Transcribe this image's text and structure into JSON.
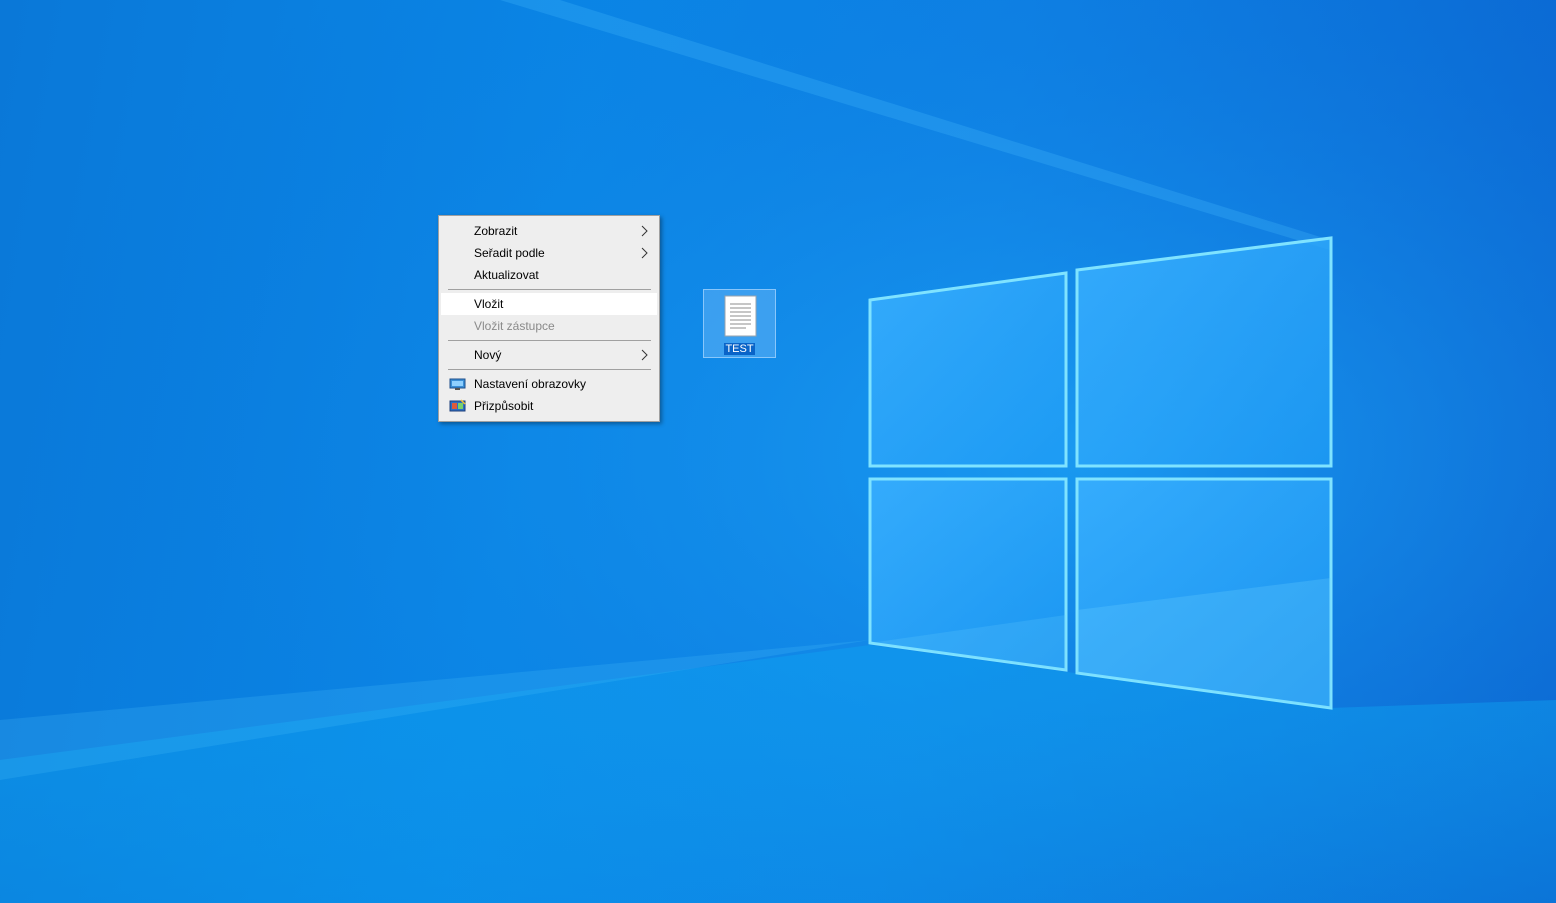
{
  "desktop": {
    "icons": [
      {
        "label": "TEST",
        "icon": "text-document-icon"
      }
    ]
  },
  "context_menu": {
    "items": [
      {
        "label": "Zobrazit",
        "has_submenu": true
      },
      {
        "label": "Seřadit podle",
        "has_submenu": true
      },
      {
        "label": "Aktualizovat"
      },
      {
        "label": "Vložit",
        "highlighted": true
      },
      {
        "label": "Vložit zástupce",
        "disabled": true
      },
      {
        "label": "Nový",
        "has_submenu": true
      },
      {
        "label": "Nastavení obrazovky",
        "icon": "display-settings-icon"
      },
      {
        "label": "Přizpůsobit",
        "icon": "personalize-icon"
      }
    ]
  },
  "colors": {
    "wallpaper_blue": "#0a78d8",
    "menu_background": "#eeeeee",
    "menu_highlight": "#ffffff",
    "disabled_text": "#8a8a8a",
    "selection_label": "#0a64c8"
  }
}
